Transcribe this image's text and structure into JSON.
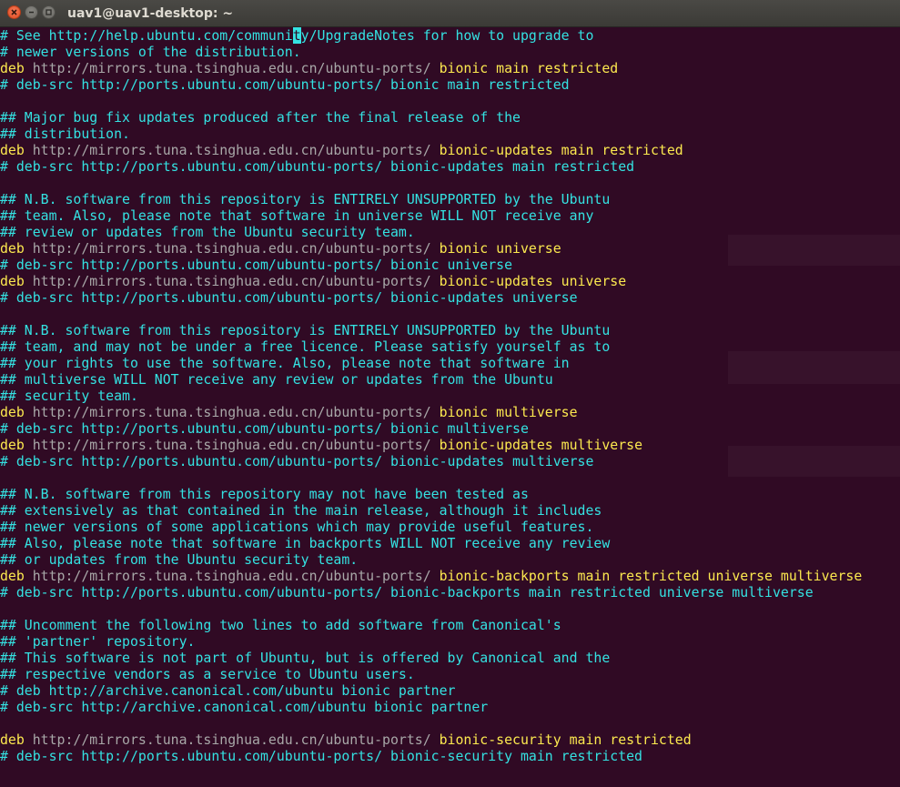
{
  "window": {
    "title": "uav1@uav1-desktop: ~",
    "buttons": {
      "close_icon": "close-icon",
      "minimize_icon": "minimize-icon",
      "maximize_icon": "maximize-icon"
    }
  },
  "colors": {
    "background": "#300a24",
    "comment": "#34e2e2",
    "keyword": "#fce94f",
    "url": "#a8a8a8"
  },
  "terminal": {
    "lines": [
      [
        {
          "t": "comment",
          "v": "# See http://help.ubuntu.com/communi"
        },
        {
          "t": "cursor",
          "v": "t"
        },
        {
          "t": "comment",
          "v": "y/UpgradeNotes for how to upgrade to"
        }
      ],
      [
        {
          "t": "comment",
          "v": "# newer versions of the distribution."
        }
      ],
      [
        {
          "t": "kw",
          "v": "deb "
        },
        {
          "t": "url",
          "v": "http://mirrors.tuna.tsinghua.edu.cn/ubuntu-ports/ "
        },
        {
          "t": "dist",
          "v": "bionic main restricted"
        }
      ],
      [
        {
          "t": "comment",
          "v": "# deb-src http://ports.ubuntu.com/ubuntu-ports/ bionic main restricted"
        }
      ],
      [
        {
          "t": "comment",
          "v": ""
        }
      ],
      [
        {
          "t": "comment",
          "v": "## Major bug fix updates produced after the final release of the"
        }
      ],
      [
        {
          "t": "comment",
          "v": "## distribution."
        }
      ],
      [
        {
          "t": "kw",
          "v": "deb "
        },
        {
          "t": "url",
          "v": "http://mirrors.tuna.tsinghua.edu.cn/ubuntu-ports/ "
        },
        {
          "t": "dist",
          "v": "bionic-updates main restricted"
        }
      ],
      [
        {
          "t": "comment",
          "v": "# deb-src http://ports.ubuntu.com/ubuntu-ports/ bionic-updates main restricted"
        }
      ],
      [
        {
          "t": "comment",
          "v": ""
        }
      ],
      [
        {
          "t": "comment",
          "v": "## N.B. software from this repository is ENTIRELY UNSUPPORTED by the Ubuntu"
        }
      ],
      [
        {
          "t": "comment",
          "v": "## team. Also, please note that software in universe WILL NOT receive any"
        }
      ],
      [
        {
          "t": "comment",
          "v": "## review or updates from the Ubuntu security team."
        }
      ],
      [
        {
          "t": "kw",
          "v": "deb "
        },
        {
          "t": "url",
          "v": "http://mirrors.tuna.tsinghua.edu.cn/ubuntu-ports/ "
        },
        {
          "t": "dist",
          "v": "bionic universe"
        }
      ],
      [
        {
          "t": "comment",
          "v": "# deb-src http://ports.ubuntu.com/ubuntu-ports/ bionic universe"
        }
      ],
      [
        {
          "t": "kw",
          "v": "deb "
        },
        {
          "t": "url",
          "v": "http://mirrors.tuna.tsinghua.edu.cn/ubuntu-ports/ "
        },
        {
          "t": "dist",
          "v": "bionic-updates universe"
        }
      ],
      [
        {
          "t": "comment",
          "v": "# deb-src http://ports.ubuntu.com/ubuntu-ports/ bionic-updates universe"
        }
      ],
      [
        {
          "t": "comment",
          "v": ""
        }
      ],
      [
        {
          "t": "comment",
          "v": "## N.B. software from this repository is ENTIRELY UNSUPPORTED by the Ubuntu"
        }
      ],
      [
        {
          "t": "comment",
          "v": "## team, and may not be under a free licence. Please satisfy yourself as to"
        }
      ],
      [
        {
          "t": "comment",
          "v": "## your rights to use the software. Also, please note that software in"
        }
      ],
      [
        {
          "t": "comment",
          "v": "## multiverse WILL NOT receive any review or updates from the Ubuntu"
        }
      ],
      [
        {
          "t": "comment",
          "v": "## security team."
        }
      ],
      [
        {
          "t": "kw",
          "v": "deb "
        },
        {
          "t": "url",
          "v": "http://mirrors.tuna.tsinghua.edu.cn/ubuntu-ports/ "
        },
        {
          "t": "dist",
          "v": "bionic multiverse"
        }
      ],
      [
        {
          "t": "comment",
          "v": "# deb-src http://ports.ubuntu.com/ubuntu-ports/ bionic multiverse"
        }
      ],
      [
        {
          "t": "kw",
          "v": "deb "
        },
        {
          "t": "url",
          "v": "http://mirrors.tuna.tsinghua.edu.cn/ubuntu-ports/ "
        },
        {
          "t": "dist",
          "v": "bionic-updates multiverse"
        }
      ],
      [
        {
          "t": "comment",
          "v": "# deb-src http://ports.ubuntu.com/ubuntu-ports/ bionic-updates multiverse"
        }
      ],
      [
        {
          "t": "comment",
          "v": ""
        }
      ],
      [
        {
          "t": "comment",
          "v": "## N.B. software from this repository may not have been tested as"
        }
      ],
      [
        {
          "t": "comment",
          "v": "## extensively as that contained in the main release, although it includes"
        }
      ],
      [
        {
          "t": "comment",
          "v": "## newer versions of some applications which may provide useful features."
        }
      ],
      [
        {
          "t": "comment",
          "v": "## Also, please note that software in backports WILL NOT receive any review"
        }
      ],
      [
        {
          "t": "comment",
          "v": "## or updates from the Ubuntu security team."
        }
      ],
      [
        {
          "t": "kw",
          "v": "deb "
        },
        {
          "t": "url",
          "v": "http://mirrors.tuna.tsinghua.edu.cn/ubuntu-ports/ "
        },
        {
          "t": "dist",
          "v": "bionic-backports main restricted universe multiverse"
        }
      ],
      [
        {
          "t": "comment",
          "v": "# deb-src http://ports.ubuntu.com/ubuntu-ports/ bionic-backports main restricted universe multiverse"
        }
      ],
      [
        {
          "t": "comment",
          "v": ""
        }
      ],
      [
        {
          "t": "comment",
          "v": "## Uncomment the following two lines to add software from Canonical's"
        }
      ],
      [
        {
          "t": "comment",
          "v": "## 'partner' repository."
        }
      ],
      [
        {
          "t": "comment",
          "v": "## This software is not part of Ubuntu, but is offered by Canonical and the"
        }
      ],
      [
        {
          "t": "comment",
          "v": "## respective vendors as a service to Ubuntu users."
        }
      ],
      [
        {
          "t": "comment",
          "v": "# deb http://archive.canonical.com/ubuntu bionic partner"
        }
      ],
      [
        {
          "t": "comment",
          "v": "# deb-src http://archive.canonical.com/ubuntu bionic partner"
        }
      ],
      [
        {
          "t": "comment",
          "v": ""
        }
      ],
      [
        {
          "t": "kw",
          "v": "deb "
        },
        {
          "t": "url",
          "v": "http://mirrors.tuna.tsinghua.edu.cn/ubuntu-ports/ "
        },
        {
          "t": "dist",
          "v": "bionic-security main restricted"
        }
      ],
      [
        {
          "t": "comment",
          "v": "# deb-src http://ports.ubuntu.com/ubuntu-ports/ bionic-security main restricted"
        }
      ]
    ]
  }
}
